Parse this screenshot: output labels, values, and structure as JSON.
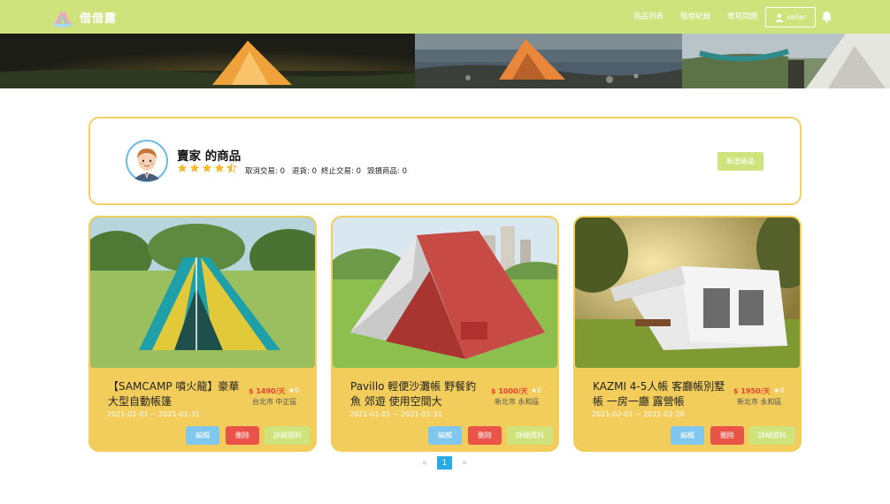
{
  "navbar": {
    "brand": "借借露",
    "links": [
      "商品列表",
      "租借紀錄",
      "常見問題"
    ],
    "user_name": "seller",
    "bg_color": "#cfe37c"
  },
  "seller": {
    "title": "賣家 的商品",
    "rating_stars": 4.5,
    "stats": {
      "cancel": "取消交易: 0",
      "return": "退貨: 0",
      "terminate": "終止交易: 0",
      "damage": "毀損商品: 0"
    },
    "add_button": "新增商品"
  },
  "products": [
    {
      "title": "【SAMCAMP 噴火龍】豪華大型自動帳篷",
      "price": "$ 1490/天",
      "rating": "★0",
      "location": "台北市 中正區",
      "dates": "2021-01-01 ~ 2021-01-31"
    },
    {
      "title": "Pavillo 輕便沙灘帳 野餐釣魚 郊遊 使用空間大",
      "price": "$ 1000/天",
      "rating": "★0",
      "location": "新北市 永和區",
      "dates": "2021-01-01 ~ 2021-01-31"
    },
    {
      "title": "KAZMI 4-5人帳 客廳帳別墅帳 一房一廳 露營帳",
      "price": "$ 1950/天",
      "rating": "★0",
      "location": "新北市 永和區",
      "dates": "2021-02-01 ~ 2021-02-28"
    }
  ],
  "card_buttons": {
    "edit": "編輯",
    "delete": "刪除",
    "detail": "詳細資料"
  },
  "pagination": {
    "prev": "«",
    "current": "1",
    "next": "»"
  },
  "colors": {
    "accent": "#cfe37c",
    "card": "#f2cd5c",
    "price": "#e8412f",
    "edit": "#7fc7ee",
    "delete": "#ea5347",
    "page_active": "#29a9e6"
  }
}
